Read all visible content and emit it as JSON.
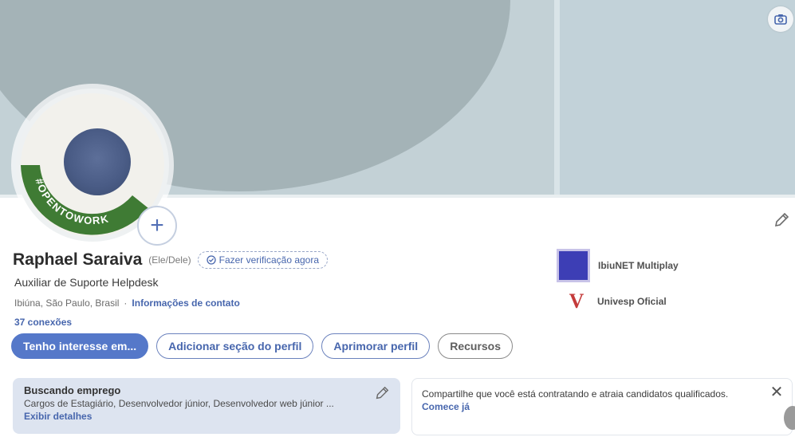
{
  "profile": {
    "name": "Raphael Saraiva",
    "pronouns": "(Ele/Dele)",
    "verify_label": "Fazer verificação agora",
    "headline": "Auxiliar de Suporte Helpdesk",
    "location": "Ibiúna, São Paulo, Brasil",
    "contact_link": "Informações de contato",
    "connections": "37 conexões",
    "avatar_badge_text": "#OPENTOWORK"
  },
  "orgs": [
    {
      "name": "IbiuNET Multiplay"
    },
    {
      "name": "Univesp Oficial",
      "logo_letter": "V"
    }
  ],
  "actions": {
    "primary": "Tenho interesse em...",
    "add_section": "Adicionar seção do perfil",
    "improve": "Aprimorar perfil",
    "resources": "Recursos"
  },
  "open_to_work": {
    "title": "Buscando emprego",
    "body": "Cargos de Estagiário, Desenvolvedor júnior, Desenvolvedor web júnior ...",
    "link": "Exibir detalhes"
  },
  "hiring": {
    "title": "Compartilhe que você está contratando e atraia candidatos qualificados.",
    "link": "Comece já",
    "close_glyph": "✕"
  },
  "colors": {
    "accent": "#4766ad",
    "primary_button": "#5578c9",
    "opentowork_green": "#3f7b34",
    "cover": "#a4b3b7"
  }
}
